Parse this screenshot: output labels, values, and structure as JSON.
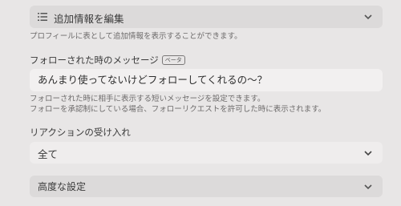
{
  "additional_info": {
    "label": "追加情報を編集"
  },
  "profile_help": "プロフィールに表として追加情報を表示することができます。",
  "follow_message": {
    "label": "フォローされた時のメッセージ",
    "badge": "ベータ",
    "value": "あんまり使ってないけどフォローしてくれるの～？",
    "help_line1": "フォローされた時に相手に表示する短いメッセージを設定できます。",
    "help_line2": "フォローを承認制にしている場合、フォローリクエストを許可した時に表示されます。"
  },
  "reaction": {
    "label": "リアクションの受け入れ",
    "selected": "全て"
  },
  "advanced": {
    "label": "高度な設定"
  },
  "colors": {
    "background": "#e8e6e6",
    "panel": "#dcdada",
    "input": "#f2f0f0"
  }
}
